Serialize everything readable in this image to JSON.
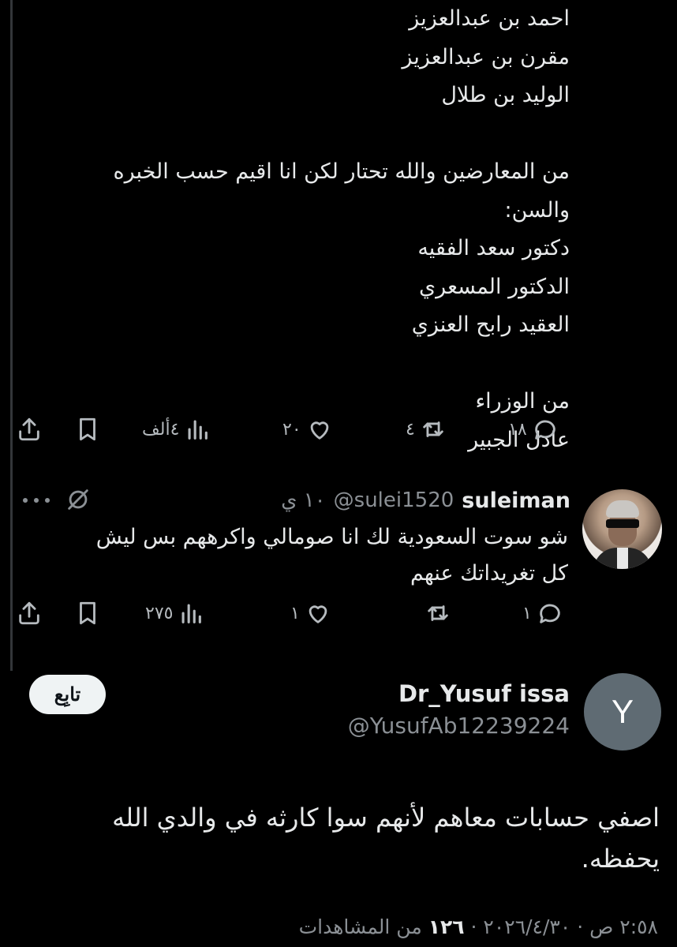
{
  "parent_tweet": {
    "lines": [
      "احمد بن عبدالعزيز",
      "مقرن بن عبدالعزيز",
      "الوليد بن طلال",
      "",
      "من المعارضين والله تحتار لكن انا اقيم  حسب الخبره",
      "والسن:",
      "دكتور سعد الفقيه",
      "الدكتور المسعري",
      "العقيد رابح العنزي",
      "",
      "من الوزراء",
      "عادل الجبير"
    ],
    "actions": {
      "replies": "١٨",
      "retweets": "٤",
      "likes": "٢٠",
      "views": "٤ألف"
    }
  },
  "reply": {
    "display_name": "suleiman",
    "handle": "@sulei1520",
    "time": "١٠ ي",
    "text_lines": [
      "شو سوت السعودية لك انا صومالي واكرههم بس ليش",
      "كل تغريداتك عنهم"
    ],
    "actions": {
      "replies": "١",
      "retweets": "",
      "likes": "١",
      "views": "٢٧٥"
    }
  },
  "main_tweet": {
    "avatar_letter": "Y",
    "display_name": "Dr_Yusuf issa",
    "handle": "@YusufAb12239224",
    "follow_label": "تابِع",
    "text_lines": [
      "اصفي حسابات معاهم لأنهم سوا كارثه في والدي الله",
      "يحفظه."
    ],
    "timestamp": "٢:٥٨ ص · ٢٠٢٦/٤/٣٠ ·",
    "views_count": "١٢٦",
    "views_label": "من المشاهدات"
  },
  "colors": {
    "background": "#000000",
    "text": "#e7e9ea",
    "secondary": "#8b9095",
    "avatar_y": "#5f6b73"
  }
}
